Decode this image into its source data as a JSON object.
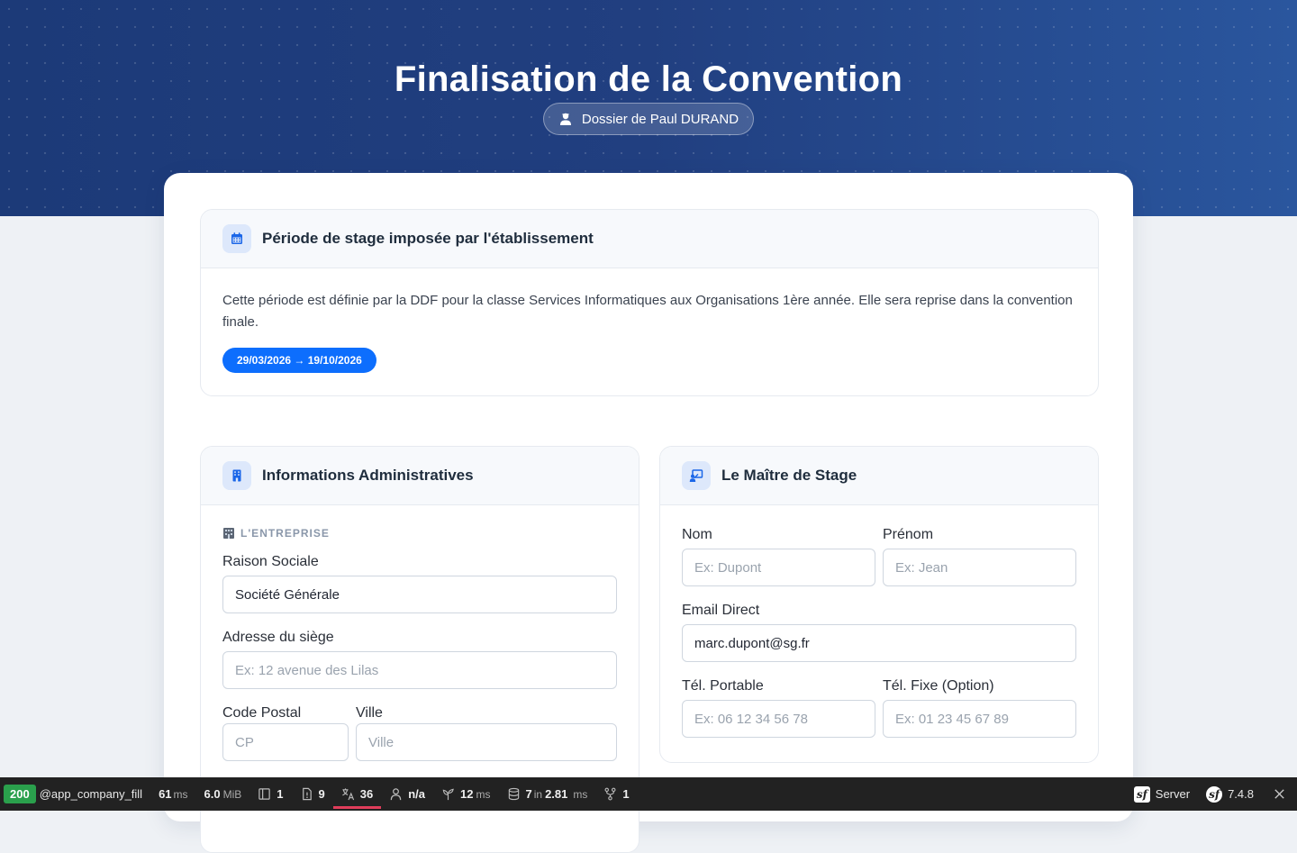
{
  "header": {
    "title": "Finalisation de la Convention",
    "dossier_label": "Dossier de Paul DURAND"
  },
  "periode": {
    "title": "Période de stage imposée par l'établissement",
    "description": "Cette période est définie par la DDF pour la classe Services Informatiques aux Organisations 1ère année. Elle sera reprise dans la convention finale.",
    "dates": "29/03/2026 → 19/10/2026"
  },
  "admin": {
    "title": "Informations Administratives",
    "section_label": "L'ENTREPRISE",
    "raison_sociale_label": "Raison Sociale",
    "raison_sociale_value": "Société Générale",
    "adresse_label": "Adresse du siège",
    "adresse_placeholder": "Ex: 12 avenue des Lilas",
    "cp_label": "Code Postal",
    "cp_placeholder": "CP",
    "ville_label": "Ville",
    "ville_placeholder": "Ville"
  },
  "maitre": {
    "title": "Le Maître de Stage",
    "nom_label": "Nom",
    "nom_placeholder": "Ex: Dupont",
    "prenom_label": "Prénom",
    "prenom_placeholder": "Ex: Jean",
    "email_label": "Email Direct",
    "email_value": "marc.dupont@sg.fr",
    "tel_portable_label": "Tél. Portable",
    "tel_portable_placeholder": "Ex: 06 12 34 56 78",
    "tel_fixe_label": "Tél. Fixe (Option)",
    "tel_fixe_placeholder": "Ex: 01 23 45 67 89"
  },
  "debug_toolbar": {
    "status": "200",
    "route": "@app_company_fill",
    "time_value": "61",
    "time_unit": "ms",
    "memory_value": "6.0",
    "memory_unit": "MiB",
    "forms_count": "1",
    "logs_count": "9",
    "translations_count": "36",
    "user": "n/a",
    "twig_value": "12",
    "twig_unit": "ms",
    "db_queries": "7",
    "db_in": "in",
    "db_time": "2.81",
    "db_unit": "ms",
    "workflow_count": "1",
    "server_label": "Server",
    "symfony_version": "7.4.8",
    "accent_color": "#e03d5a",
    "status_color": "#2aa04c"
  },
  "colors": {
    "primary": "#0d6efd",
    "hero": "#1f3f7e",
    "icon_bg": "#dde8fb"
  }
}
